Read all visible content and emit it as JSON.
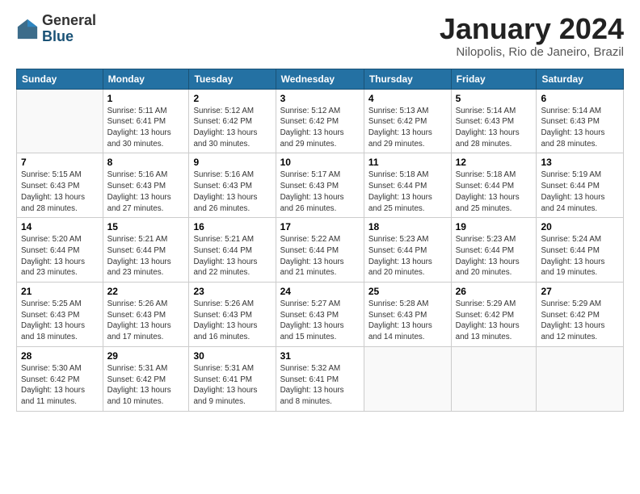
{
  "header": {
    "logo_general": "General",
    "logo_blue": "Blue",
    "month_title": "January 2024",
    "location": "Nilopolis, Rio de Janeiro, Brazil"
  },
  "weekdays": [
    "Sunday",
    "Monday",
    "Tuesday",
    "Wednesday",
    "Thursday",
    "Friday",
    "Saturday"
  ],
  "weeks": [
    [
      {
        "day": "",
        "info": ""
      },
      {
        "day": "1",
        "info": "Sunrise: 5:11 AM\nSunset: 6:41 PM\nDaylight: 13 hours\nand 30 minutes."
      },
      {
        "day": "2",
        "info": "Sunrise: 5:12 AM\nSunset: 6:42 PM\nDaylight: 13 hours\nand 30 minutes."
      },
      {
        "day": "3",
        "info": "Sunrise: 5:12 AM\nSunset: 6:42 PM\nDaylight: 13 hours\nand 29 minutes."
      },
      {
        "day": "4",
        "info": "Sunrise: 5:13 AM\nSunset: 6:42 PM\nDaylight: 13 hours\nand 29 minutes."
      },
      {
        "day": "5",
        "info": "Sunrise: 5:14 AM\nSunset: 6:43 PM\nDaylight: 13 hours\nand 28 minutes."
      },
      {
        "day": "6",
        "info": "Sunrise: 5:14 AM\nSunset: 6:43 PM\nDaylight: 13 hours\nand 28 minutes."
      }
    ],
    [
      {
        "day": "7",
        "info": "Sunrise: 5:15 AM\nSunset: 6:43 PM\nDaylight: 13 hours\nand 28 minutes."
      },
      {
        "day": "8",
        "info": "Sunrise: 5:16 AM\nSunset: 6:43 PM\nDaylight: 13 hours\nand 27 minutes."
      },
      {
        "day": "9",
        "info": "Sunrise: 5:16 AM\nSunset: 6:43 PM\nDaylight: 13 hours\nand 26 minutes."
      },
      {
        "day": "10",
        "info": "Sunrise: 5:17 AM\nSunset: 6:43 PM\nDaylight: 13 hours\nand 26 minutes."
      },
      {
        "day": "11",
        "info": "Sunrise: 5:18 AM\nSunset: 6:44 PM\nDaylight: 13 hours\nand 25 minutes."
      },
      {
        "day": "12",
        "info": "Sunrise: 5:18 AM\nSunset: 6:44 PM\nDaylight: 13 hours\nand 25 minutes."
      },
      {
        "day": "13",
        "info": "Sunrise: 5:19 AM\nSunset: 6:44 PM\nDaylight: 13 hours\nand 24 minutes."
      }
    ],
    [
      {
        "day": "14",
        "info": "Sunrise: 5:20 AM\nSunset: 6:44 PM\nDaylight: 13 hours\nand 23 minutes."
      },
      {
        "day": "15",
        "info": "Sunrise: 5:21 AM\nSunset: 6:44 PM\nDaylight: 13 hours\nand 23 minutes."
      },
      {
        "day": "16",
        "info": "Sunrise: 5:21 AM\nSunset: 6:44 PM\nDaylight: 13 hours\nand 22 minutes."
      },
      {
        "day": "17",
        "info": "Sunrise: 5:22 AM\nSunset: 6:44 PM\nDaylight: 13 hours\nand 21 minutes."
      },
      {
        "day": "18",
        "info": "Sunrise: 5:23 AM\nSunset: 6:44 PM\nDaylight: 13 hours\nand 20 minutes."
      },
      {
        "day": "19",
        "info": "Sunrise: 5:23 AM\nSunset: 6:44 PM\nDaylight: 13 hours\nand 20 minutes."
      },
      {
        "day": "20",
        "info": "Sunrise: 5:24 AM\nSunset: 6:44 PM\nDaylight: 13 hours\nand 19 minutes."
      }
    ],
    [
      {
        "day": "21",
        "info": "Sunrise: 5:25 AM\nSunset: 6:43 PM\nDaylight: 13 hours\nand 18 minutes."
      },
      {
        "day": "22",
        "info": "Sunrise: 5:26 AM\nSunset: 6:43 PM\nDaylight: 13 hours\nand 17 minutes."
      },
      {
        "day": "23",
        "info": "Sunrise: 5:26 AM\nSunset: 6:43 PM\nDaylight: 13 hours\nand 16 minutes."
      },
      {
        "day": "24",
        "info": "Sunrise: 5:27 AM\nSunset: 6:43 PM\nDaylight: 13 hours\nand 15 minutes."
      },
      {
        "day": "25",
        "info": "Sunrise: 5:28 AM\nSunset: 6:43 PM\nDaylight: 13 hours\nand 14 minutes."
      },
      {
        "day": "26",
        "info": "Sunrise: 5:29 AM\nSunset: 6:42 PM\nDaylight: 13 hours\nand 13 minutes."
      },
      {
        "day": "27",
        "info": "Sunrise: 5:29 AM\nSunset: 6:42 PM\nDaylight: 13 hours\nand 12 minutes."
      }
    ],
    [
      {
        "day": "28",
        "info": "Sunrise: 5:30 AM\nSunset: 6:42 PM\nDaylight: 13 hours\nand 11 minutes."
      },
      {
        "day": "29",
        "info": "Sunrise: 5:31 AM\nSunset: 6:42 PM\nDaylight: 13 hours\nand 10 minutes."
      },
      {
        "day": "30",
        "info": "Sunrise: 5:31 AM\nSunset: 6:41 PM\nDaylight: 13 hours\nand 9 minutes."
      },
      {
        "day": "31",
        "info": "Sunrise: 5:32 AM\nSunset: 6:41 PM\nDaylight: 13 hours\nand 8 minutes."
      },
      {
        "day": "",
        "info": ""
      },
      {
        "day": "",
        "info": ""
      },
      {
        "day": "",
        "info": ""
      }
    ]
  ]
}
